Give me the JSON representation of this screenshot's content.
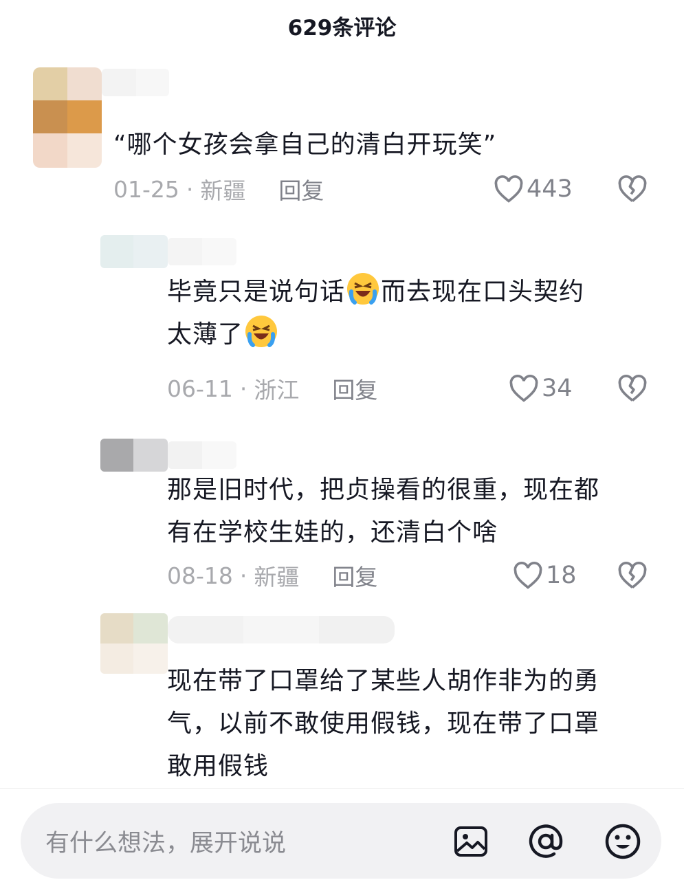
{
  "header": {
    "title": "629条评论"
  },
  "comments": [
    {
      "text": "“哪个女孩会拿自己的清白开玩笑”",
      "date": "01-25",
      "location": "新疆",
      "reply_label": "回复",
      "likes": "443"
    },
    {
      "text_part1": "毕竟只是说句话",
      "text_part2": "而去现在口头契约",
      "text_part3": "太薄了",
      "date": "06-11",
      "location": "浙江",
      "reply_label": "回复",
      "likes": "34"
    },
    {
      "text_line1": "那是旧时代，把贞操看的很重，现在都",
      "text_line2": "有在学校生娃的，还清白个啥",
      "date": "08-18",
      "location": "新疆",
      "reply_label": "回复",
      "likes": "18"
    },
    {
      "text_line1": "现在带了口罩给了某些人胡作非为的勇",
      "text_line2": "气，以前不敢使用假钱，现在带了口罩",
      "text_line3": "敢用假钱"
    }
  ],
  "icons": {
    "like": "heart-outline-icon",
    "dislike": "broken-heart-icon",
    "emoji_inline": "laughing-crying-emoji",
    "image": "image-icon",
    "mention": "at-icon",
    "emoji": "smiley-icon"
  },
  "input": {
    "placeholder": "有什么想法，展开说说"
  },
  "colors": {
    "text": "#161823",
    "meta": "#a8a9ad",
    "accent": "#80828a",
    "input_bg": "#f1f1f3"
  }
}
